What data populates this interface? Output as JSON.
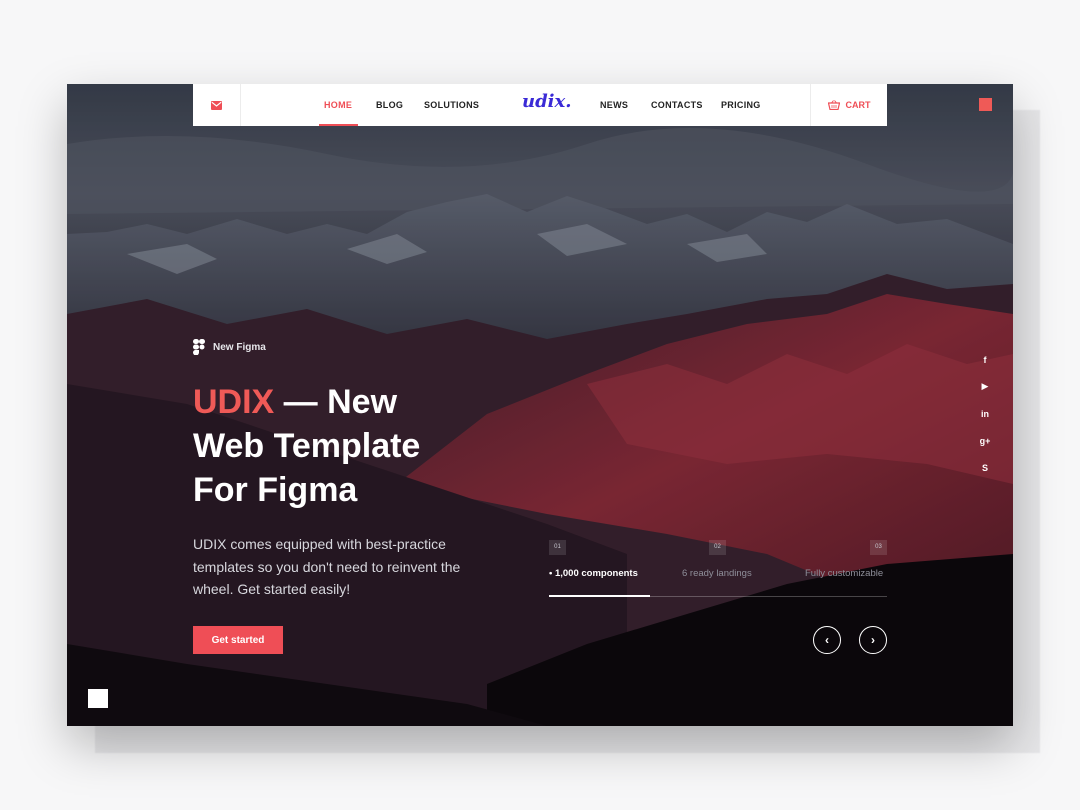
{
  "nav": {
    "items_left": [
      {
        "label": "HOME",
        "active": true
      },
      {
        "label": "BLOG",
        "active": false
      },
      {
        "label": "SOLUTIONS",
        "active": false
      }
    ],
    "logo": "udix.",
    "items_right": [
      {
        "label": "NEWS"
      },
      {
        "label": "CONTACTS"
      },
      {
        "label": "PRICING"
      }
    ],
    "cart_label": "CART",
    "mail_icon": "mail-icon",
    "cart_icon": "basket-icon"
  },
  "hero": {
    "badge": "New Figma",
    "headline_accent": "UDIX",
    "headline_rest_1": " — New",
    "headline_line_2": "Web Template",
    "headline_line_3": "For Figma",
    "description": "UDIX comes equipped with best-practice templates so you don't need to reinvent the wheel. Get started easily!",
    "cta_label": "Get started"
  },
  "features": [
    {
      "number": "01",
      "label": "• 1,000 components",
      "active": true
    },
    {
      "number": "02",
      "label": "6 ready landings",
      "active": false
    },
    {
      "number": "03",
      "label": "Fully customizable",
      "active": false
    }
  ],
  "carousel": {
    "prev": "‹",
    "next": "›",
    "progress": 0.3
  },
  "social": [
    "f",
    "▶",
    "in",
    "g+",
    "S"
  ],
  "colors": {
    "accent": "#ef4e56",
    "logo": "#3a2ad6",
    "white": "#ffffff"
  }
}
